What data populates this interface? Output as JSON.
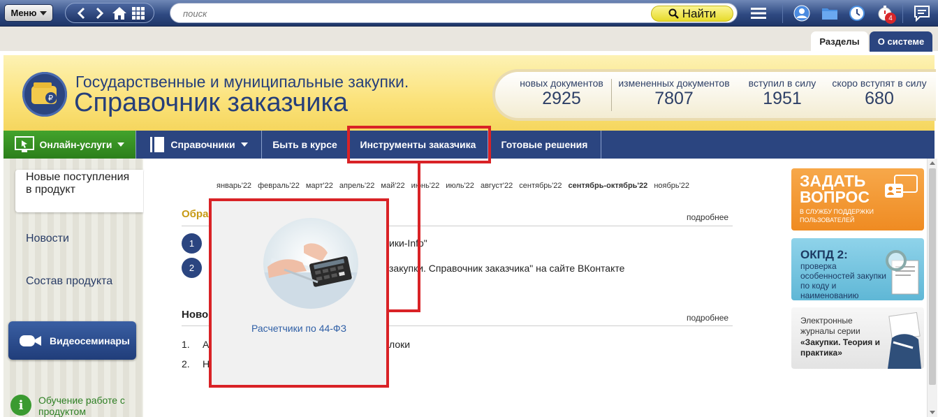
{
  "toolbar": {
    "menu_label": "Меню",
    "search_placeholder": "поиск",
    "find_label": "Найти",
    "notifications_count": "4"
  },
  "tabs": {
    "sections": "Разделы",
    "about": "О системе"
  },
  "header": {
    "subtitle": "Государственные и муниципальные закупки.",
    "title": "Справочник заказчика",
    "stats": [
      {
        "label": "новых документов",
        "value": "2925"
      },
      {
        "label": "измененных документов",
        "value": "7807"
      },
      {
        "label": "вступил в силу",
        "value": "1951"
      },
      {
        "label": "скоро вступят в силу",
        "value": "680"
      }
    ]
  },
  "nav": {
    "items": [
      {
        "label": "Онлайн-услуги"
      },
      {
        "label": "Справочники"
      },
      {
        "label": "Быть в курсе"
      },
      {
        "label": "Инструменты заказчика"
      },
      {
        "label": "Готовые решения"
      }
    ]
  },
  "left": {
    "active": "Новые поступления в продукт",
    "news": "Новости",
    "composition": "Состав продукта",
    "webinars": "Видеосеминары",
    "learning": "Обучение работе с продуктом"
  },
  "main": {
    "months": [
      "январь'22",
      "февраль'22",
      "март'22",
      "апрель'22",
      "май'22",
      "июнь'22",
      "июль'22",
      "август'22",
      "сентябрь'22",
      "сентябрь-октябрь'22",
      "ноябрь'22"
    ],
    "current_month": "сентябрь-октябрь'22",
    "section1_title": "Обра",
    "section1_more": "подробнее",
    "section1_items": [
      {
        "num": "1",
        "tail": "ики-Info\""
      },
      {
        "num": "2",
        "tail": "закупки. Справочник заказчика\" на сайте ВКонтакте"
      }
    ],
    "section2_title": "Ново",
    "section2_more": "подробнее",
    "section2_items": [
      {
        "num": "1.",
        "head": "А",
        "tail": "локи"
      },
      {
        "num": "2.",
        "head": "Н",
        "tail": ""
      }
    ]
  },
  "popup": {
    "label": "Расчетчики по 44-ФЗ"
  },
  "promos": {
    "ask_title": "ЗАДАТЬ ВОПРОС",
    "ask_sub": "В СЛУЖБУ ПОДДЕРЖКИ ПОЛЬЗОВАТЕЛЕЙ",
    "okpd_title": "ОКПД 2:",
    "okpd_sub": "проверка особенностей закупки по коду и наименованию",
    "journal_pre": "Электронные журналы серии",
    "journal_name": "«Закупки. Теория и практика»"
  },
  "colors": {
    "navy": "#2b4580",
    "highlight": "#d92226",
    "green": "#3a9a30"
  }
}
